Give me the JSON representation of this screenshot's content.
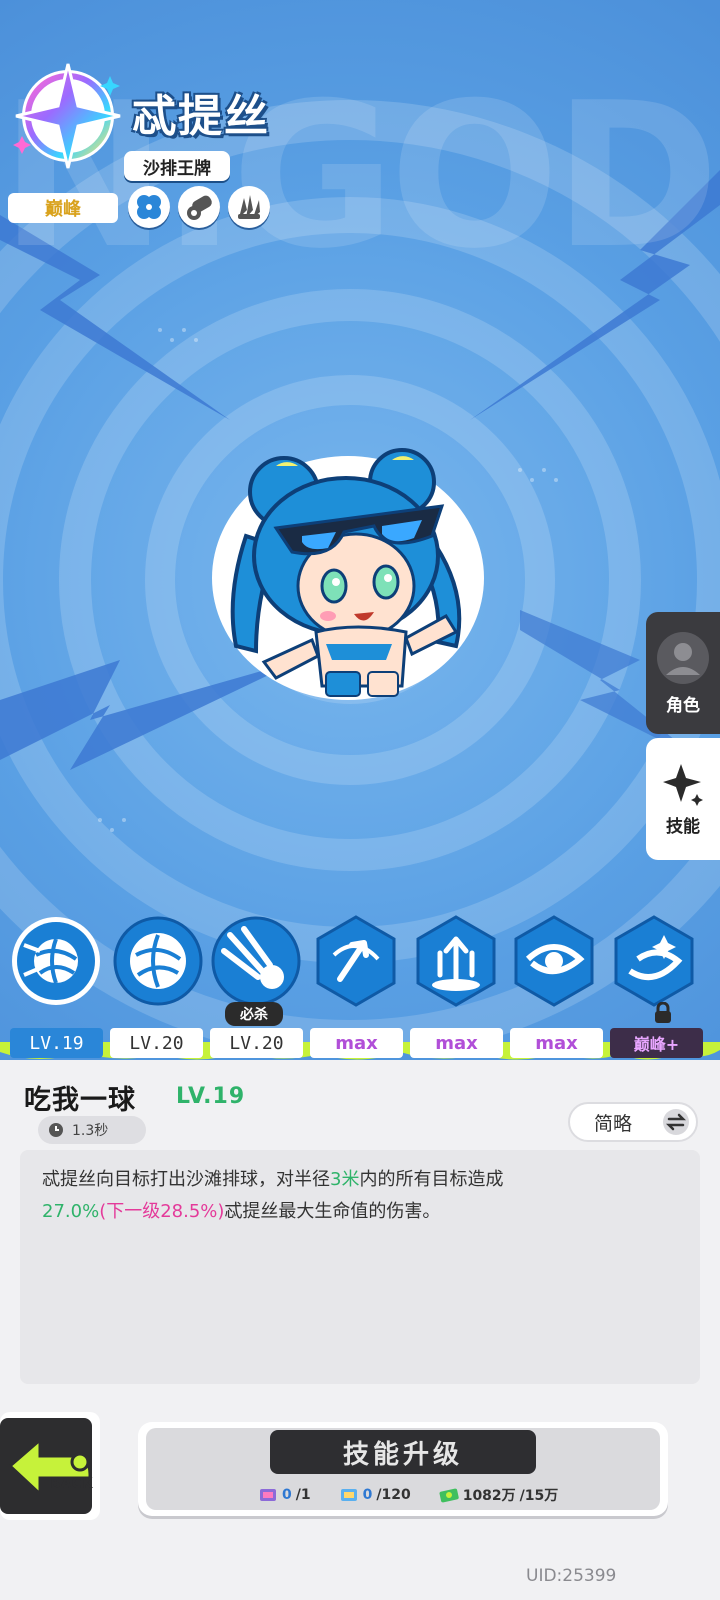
{
  "background_text": "N.GOD",
  "hero": {
    "name": "忒提丝",
    "title": "沙排王牌",
    "rank": "巅峰",
    "traits": [
      "clover-icon",
      "cannon-icon",
      "claw-icon"
    ]
  },
  "side_tabs": [
    {
      "label": "角色",
      "icon": "avatar-icon"
    },
    {
      "label": "技能",
      "icon": "sparkle-icon"
    }
  ],
  "skills": [
    {
      "icon": "volleyball-icon",
      "level": "LV.19",
      "selected": true
    },
    {
      "icon": "volleyball-icon",
      "level": "LV.20"
    },
    {
      "icon": "spike-icon",
      "level": "LV.20",
      "tag": "必杀"
    },
    {
      "icon": "arrow-icon",
      "level": "max"
    },
    {
      "icon": "fountain-icon",
      "level": "max"
    },
    {
      "icon": "vortex-icon",
      "level": "max"
    },
    {
      "icon": "swirl-icon",
      "level": "巅峰+",
      "locked": true
    }
  ],
  "detail": {
    "name": "吃我一球",
    "level": "LV.19",
    "cooldown": "1.3秒",
    "toggle_label": "简略",
    "desc": {
      "p1": "忒提丝向目标打出沙滩排球，对半径",
      "radius": "3米",
      "p2": "内的所有目标造成",
      "value": "27.0%",
      "next": "(下一级28.5%)",
      "p3": "忒提丝最大生命值的伤害。"
    }
  },
  "upgrade": {
    "label": "技能升级",
    "costs": [
      {
        "icon": "book-icon",
        "have": "0",
        "need": "/1"
      },
      {
        "icon": "scroll-icon",
        "have": "0",
        "need": "/120"
      },
      {
        "icon": "cash-icon",
        "have": "1082万",
        "need": "/15万"
      }
    ]
  },
  "back_label": "BACK",
  "uid": "UID:25399",
  "colors": {
    "accent_blue": "#2a86d8",
    "green": "#2fb36a",
    "pink": "#e43a9a",
    "max_purple": "#b14fd8"
  }
}
